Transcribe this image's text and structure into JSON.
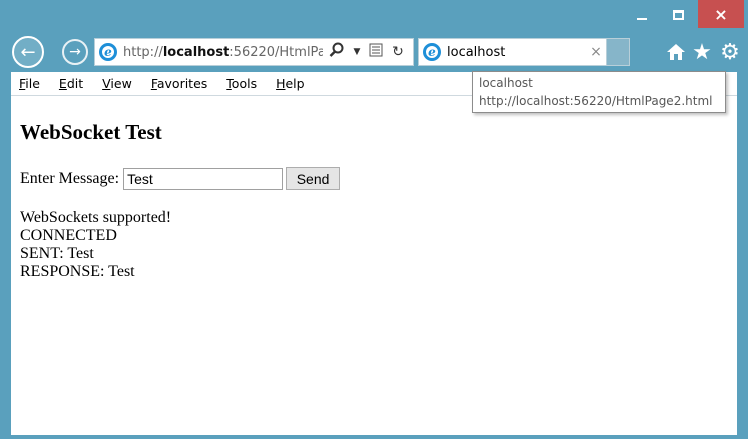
{
  "window": {
    "close_glyph": "×"
  },
  "nav": {
    "back_glyph": "←",
    "forward_glyph": "→",
    "url_prefix": "http://",
    "url_host": "localhost",
    "url_suffix": ":56220/HtmlPa"
  },
  "tab": {
    "title": "localhost",
    "close_glyph": "×"
  },
  "toolbar_icons": {
    "home": "⌂",
    "favorites": "★",
    "settings": "⚙"
  },
  "menu": {
    "items": [
      "File",
      "Edit",
      "View",
      "Favorites",
      "Tools",
      "Help"
    ]
  },
  "tooltip": {
    "title": "localhost",
    "url": "http://localhost:56220/HtmlPage2.html"
  },
  "page": {
    "heading": "WebSocket Test",
    "message_label": "Enter Message:",
    "message_value": "Test",
    "send_label": "Send",
    "output_lines": [
      "WebSockets supported!",
      "CONNECTED",
      "SENT: Test",
      "RESPONSE: Test"
    ]
  },
  "colors": {
    "frame": "#5aa0bd",
    "close_button": "#c75050",
    "ie_blue": "#1e8fd8"
  }
}
